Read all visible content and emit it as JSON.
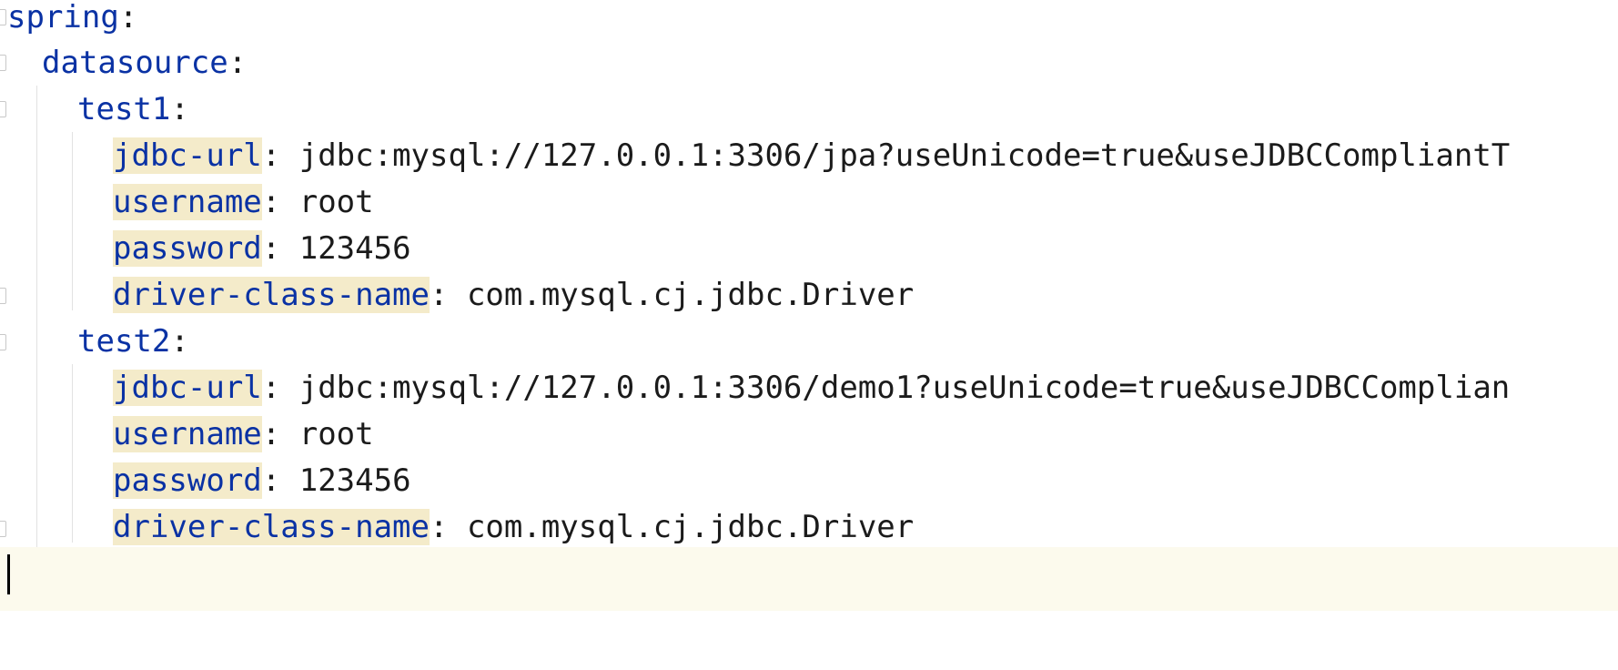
{
  "editor": {
    "colors": {
      "key": "#0a32a4",
      "value": "#1b1b1b",
      "key_highlight": "#f4ebca",
      "current_line": "#fcfaed"
    },
    "lines": [
      {
        "key": "spring",
        "sep": ":",
        "value": ""
      },
      {
        "key": "datasource",
        "sep": ":",
        "value": ""
      },
      {
        "key": "test1",
        "sep": ":",
        "value": ""
      },
      {
        "key": "jdbc-url",
        "sep": ":",
        "value": " jdbc:mysql://127.0.0.1:3306/jpa?useUnicode=true&useJDBCCompliantT"
      },
      {
        "key": "username",
        "sep": ":",
        "value": " root"
      },
      {
        "key": "password",
        "sep": ":",
        "value": " 123456"
      },
      {
        "key": "driver-class-name",
        "sep": ":",
        "value": " com.mysql.cj.jdbc.Driver"
      },
      {
        "key": "test2",
        "sep": ":",
        "value": ""
      },
      {
        "key": "jdbc-url",
        "sep": ":",
        "value": " jdbc:mysql://127.0.0.1:3306/demo1?useUnicode=true&useJDBCComplian"
      },
      {
        "key": "username",
        "sep": ":",
        "value": " root"
      },
      {
        "key": "password",
        "sep": ":",
        "value": " 123456"
      },
      {
        "key": "driver-class-name",
        "sep": ":",
        "value": " com.mysql.cj.jdbc.Driver"
      },
      {
        "key": "",
        "sep": "",
        "value": ""
      }
    ]
  }
}
